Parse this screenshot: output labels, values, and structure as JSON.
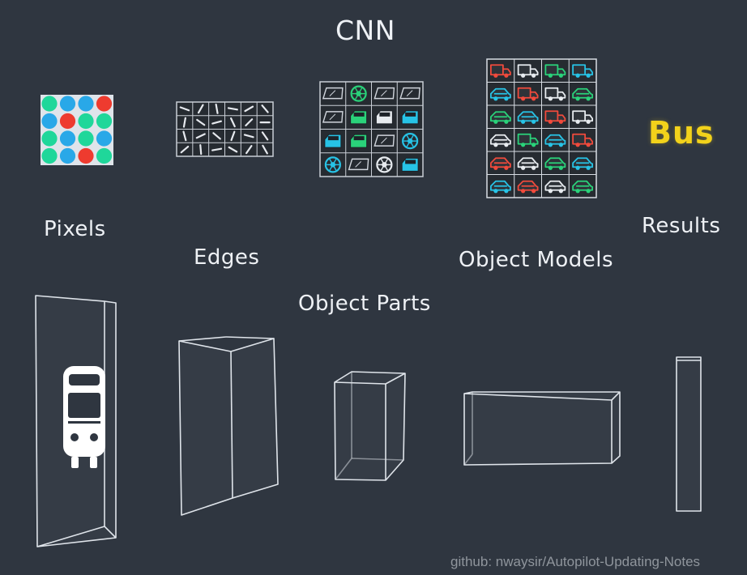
{
  "title": "CNN",
  "labels": {
    "pixels": "Pixels",
    "edges": "Edges",
    "object_parts": "Object Parts",
    "object_models": "Object Models",
    "results": "Results"
  },
  "result_word": "Bus",
  "credit": "github: nwaysir/Autopilot-Updating-Notes",
  "colors": {
    "background": "#2f3640",
    "pixel_green": "#1fd79a",
    "pixel_blue": "#29a8e8",
    "pixel_red": "#ee3b2f",
    "result_yellow": "#f2d21b",
    "icon_cyan": "#27c3e6",
    "icon_green": "#2ad27a",
    "icon_red": "#f04a3c"
  },
  "pixel_grid": [
    [
      "green",
      "blue",
      "blue",
      "red"
    ],
    [
      "blue",
      "red",
      "green",
      "green"
    ],
    [
      "green",
      "blue",
      "green",
      "blue"
    ],
    [
      "green",
      "blue",
      "red",
      "green"
    ]
  ],
  "layer_icons": {
    "object_parts": [
      [
        "window",
        "wheel",
        "window",
        "window"
      ],
      [
        "window",
        "car-door",
        "car-door",
        "car-door"
      ],
      [
        "car-door",
        "car-door",
        "window",
        "wheel"
      ],
      [
        "wheel",
        "window",
        "wheel",
        "car-door"
      ]
    ],
    "object_models": [
      [
        "truck",
        "truck",
        "truck",
        "truck"
      ],
      [
        "car",
        "truck",
        "truck",
        "car"
      ],
      [
        "car",
        "car",
        "truck",
        "truck"
      ],
      [
        "car",
        "truck",
        "car",
        "truck"
      ],
      [
        "car",
        "car",
        "car",
        "car"
      ],
      [
        "car",
        "car",
        "car",
        "car"
      ]
    ]
  },
  "layer_volumes": [
    "input-image-bus-icon",
    "edges-volume",
    "object-parts-volume",
    "object-models-volume",
    "results-volume"
  ]
}
